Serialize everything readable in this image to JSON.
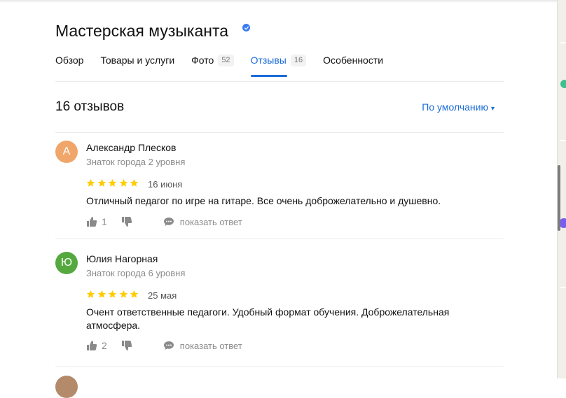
{
  "org": {
    "name": "Мастерская музыканта",
    "verified_icon": "verified-check-icon"
  },
  "tabs": [
    {
      "label": "Обзор",
      "count": ""
    },
    {
      "label": "Товары и услуги",
      "count": ""
    },
    {
      "label": "Фото",
      "count": "52"
    },
    {
      "label": "Отзывы",
      "count": "16",
      "active": true
    },
    {
      "label": "Особенности",
      "count": ""
    }
  ],
  "reviews_header": {
    "count_text": "16 отзывов",
    "sort_label": "По умолчанию",
    "sort_caret": "▾"
  },
  "colors": {
    "accent": "#1a6bd8",
    "star": "#fc0",
    "avatar_a": "#f0a66a",
    "avatar_yu": "#55a83e"
  },
  "reviews": [
    {
      "initial": "А",
      "author": "Александр Плесков",
      "level": "Знаток города 2 уровня",
      "rating": 5,
      "date": "16 июня",
      "text": "Отличный педагог по игре на гитаре. Все очень доброжелательно и душевно.",
      "likes": "1",
      "reply_label": "показать ответ"
    },
    {
      "initial": "Ю",
      "author": "Юлия Нагорная",
      "level": "Знаток города 6 уровня",
      "rating": 5,
      "date": "25 мая",
      "text": "Очент ответственные педагоги. Удобный формат обучения. Доброжелательная атмосфера.",
      "likes": "2",
      "reply_label": "показать ответ"
    }
  ]
}
